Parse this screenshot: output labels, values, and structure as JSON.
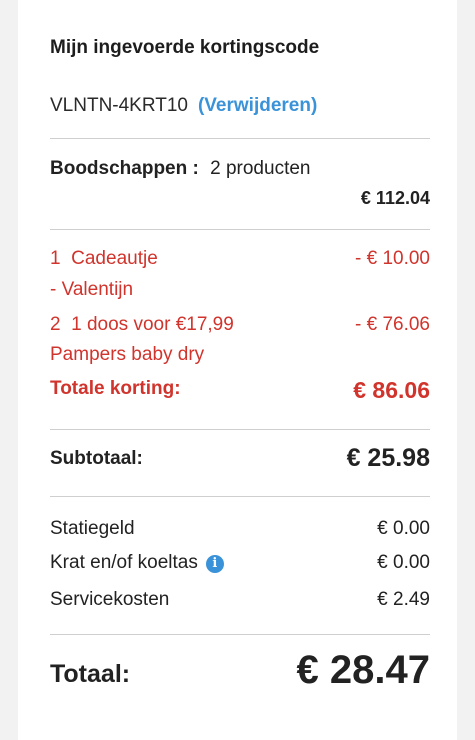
{
  "discount_code": {
    "heading": "Mijn ingevoerde kortingscode",
    "code": "VLNTN-4KRT10",
    "remove_label": "(Verwijderen)"
  },
  "groceries": {
    "label": "Boodschappen :",
    "count": "2  producten",
    "amount": "€ 112.04"
  },
  "discounts": [
    {
      "qty": "1",
      "line1": "Cadeautje",
      "line2": "- Valentijn",
      "amount": "- € 10.00"
    },
    {
      "qty": "2",
      "line1": "1 doos voor €17,99",
      "line2": "Pampers baby dry",
      "amount": "- € 76.06"
    }
  ],
  "total_discount": {
    "label": "Totale korting:",
    "amount": "€ 86.06"
  },
  "subtotal": {
    "label": "Subtotaal:",
    "amount": "€ 25.98"
  },
  "fees": [
    {
      "label": "Statiegeld",
      "amount": "€ 0.00"
    },
    {
      "label": "Krat en/of koeltas",
      "amount": "€ 0.00",
      "icon": "info-icon"
    },
    {
      "label": "Servicekosten",
      "amount": "€ 2.49"
    }
  ],
  "grand_total": {
    "label": "Totaal:",
    "amount": "€ 28.47"
  },
  "colors": {
    "accent": "#3a93d8",
    "discount_red": "#d0342c"
  }
}
